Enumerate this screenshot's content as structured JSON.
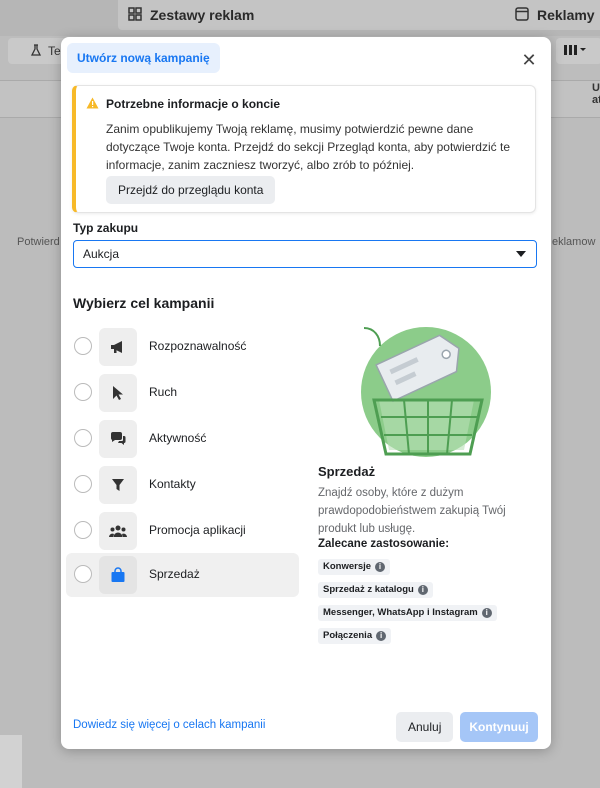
{
  "background": {
    "tab_ad_sets": "Zestawy reklam",
    "tab_ads": "Reklamy",
    "test_button": "Tes",
    "left_text": "Potwierd",
    "right_text": "eklamow",
    "right_col": "U\nat"
  },
  "modal": {
    "tab_label": "Utwórz nową kampanię",
    "close_icon": "close-icon",
    "alert": {
      "title": "Potrzebne informacje o koncie",
      "body": "Zanim opublikujemy Twoją reklamę, musimy potwierdzić pewne dane dotyczące Twoje konta. Przejdź do sekcji Przegląd konta, aby potwierdzić te informacje, zanim zaczniesz tworzyć, albo zrób to później.",
      "button": "Przejdź do przeglądu konta",
      "accent_color": "#f7b928"
    },
    "purchase_type": {
      "label": "Typ zakupu",
      "value": "Aukcja"
    },
    "objectives_title": "Wybierz cel kampanii",
    "objectives": [
      {
        "label": "Rozpoznawalność",
        "icon": "megaphone-icon"
      },
      {
        "label": "Ruch",
        "icon": "cursor-icon"
      },
      {
        "label": "Aktywność",
        "icon": "chat-icon"
      },
      {
        "label": "Kontakty",
        "icon": "funnel-icon"
      },
      {
        "label": "Promocja aplikacji",
        "icon": "people-icon"
      },
      {
        "label": "Sprzedaż",
        "icon": "shopping-bag-icon"
      }
    ],
    "detail": {
      "title": "Sprzedaż",
      "description": "Znajdź osoby, które z dużym prawdopodobieństwem zakupią Twój produkt lub usługę.",
      "recommended_title": "Zalecane zastosowanie:",
      "recommended": [
        "Konwersje",
        "Sprzedaż z katalogu",
        "Messenger, WhatsApp i Instagram",
        "Połączenia"
      ]
    },
    "footer": {
      "learn_more": "Dowiedz się więcej o celach kampanii",
      "cancel": "Anuluj",
      "continue": "Kontynuuj"
    },
    "colors": {
      "primary": "#1877f2",
      "primary_disabled": "#a5c6f7",
      "illustration_green": "#8ccc8a"
    }
  }
}
